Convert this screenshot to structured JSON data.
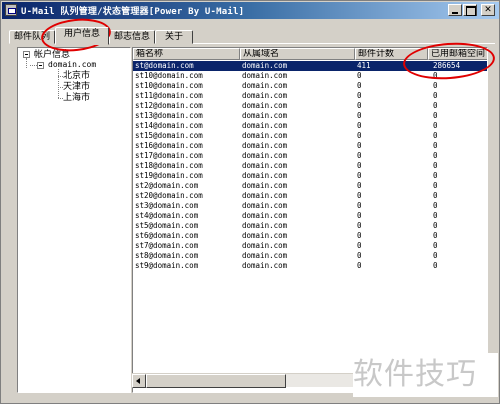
{
  "window": {
    "title": "U-Mail 队列管理/状态管理器[Power By U-Mail]"
  },
  "tabs": [
    {
      "label": "邮件队列",
      "active": false
    },
    {
      "label": "用户信息",
      "active": true
    },
    {
      "label": "邮志信息",
      "active": false
    },
    {
      "label": "关于",
      "active": false
    }
  ],
  "tree": {
    "root": "帐户信息",
    "domain": "domain.com",
    "cities": [
      "北京市",
      "天津市",
      "上海市"
    ]
  },
  "table": {
    "columns": [
      "箱名称",
      "从属域名",
      "邮件计数",
      "已用邮箱空间"
    ],
    "rows": [
      {
        "mailbox": "st@domain.com",
        "domain": "domain.com",
        "count": "411",
        "used": "286654",
        "selected": true
      },
      {
        "mailbox": "st10@domain.com",
        "domain": "domain.com",
        "count": "0",
        "used": "0"
      },
      {
        "mailbox": "st10@domain.com",
        "domain": "domain.com",
        "count": "0",
        "used": "0"
      },
      {
        "mailbox": "st11@domain.com",
        "domain": "domain.com",
        "count": "0",
        "used": "0"
      },
      {
        "mailbox": "st12@domain.com",
        "domain": "domain.com",
        "count": "0",
        "used": "0"
      },
      {
        "mailbox": "st13@domain.com",
        "domain": "domain.com",
        "count": "0",
        "used": "0"
      },
      {
        "mailbox": "st14@domain.com",
        "domain": "domain.com",
        "count": "0",
        "used": "0"
      },
      {
        "mailbox": "st15@domain.com",
        "domain": "domain.com",
        "count": "0",
        "used": "0"
      },
      {
        "mailbox": "st16@domain.com",
        "domain": "domain.com",
        "count": "0",
        "used": "0"
      },
      {
        "mailbox": "st17@domain.com",
        "domain": "domain.com",
        "count": "0",
        "used": "0"
      },
      {
        "mailbox": "st18@domain.com",
        "domain": "domain.com",
        "count": "0",
        "used": "0"
      },
      {
        "mailbox": "st19@domain.com",
        "domain": "domain.com",
        "count": "0",
        "used": "0"
      },
      {
        "mailbox": "st2@domain.com",
        "domain": "domain.com",
        "count": "0",
        "used": "0"
      },
      {
        "mailbox": "st20@domain.com",
        "domain": "domain.com",
        "count": "0",
        "used": "0"
      },
      {
        "mailbox": "st3@domain.com",
        "domain": "domain.com",
        "count": "0",
        "used": "0"
      },
      {
        "mailbox": "st4@domain.com",
        "domain": "domain.com",
        "count": "0",
        "used": "0"
      },
      {
        "mailbox": "st5@domain.com",
        "domain": "domain.com",
        "count": "0",
        "used": "0"
      },
      {
        "mailbox": "st6@domain.com",
        "domain": "domain.com",
        "count": "0",
        "used": "0"
      },
      {
        "mailbox": "st7@domain.com",
        "domain": "domain.com",
        "count": "0",
        "used": "0"
      },
      {
        "mailbox": "st8@domain.com",
        "domain": "domain.com",
        "count": "0",
        "used": "0"
      },
      {
        "mailbox": "st9@domain.com",
        "domain": "domain.com",
        "count": "0",
        "used": "0"
      }
    ]
  },
  "watermark": "软件技巧",
  "colors": {
    "selection": "#0a246a",
    "callout": "#e00000",
    "face": "#d4d0c8"
  }
}
